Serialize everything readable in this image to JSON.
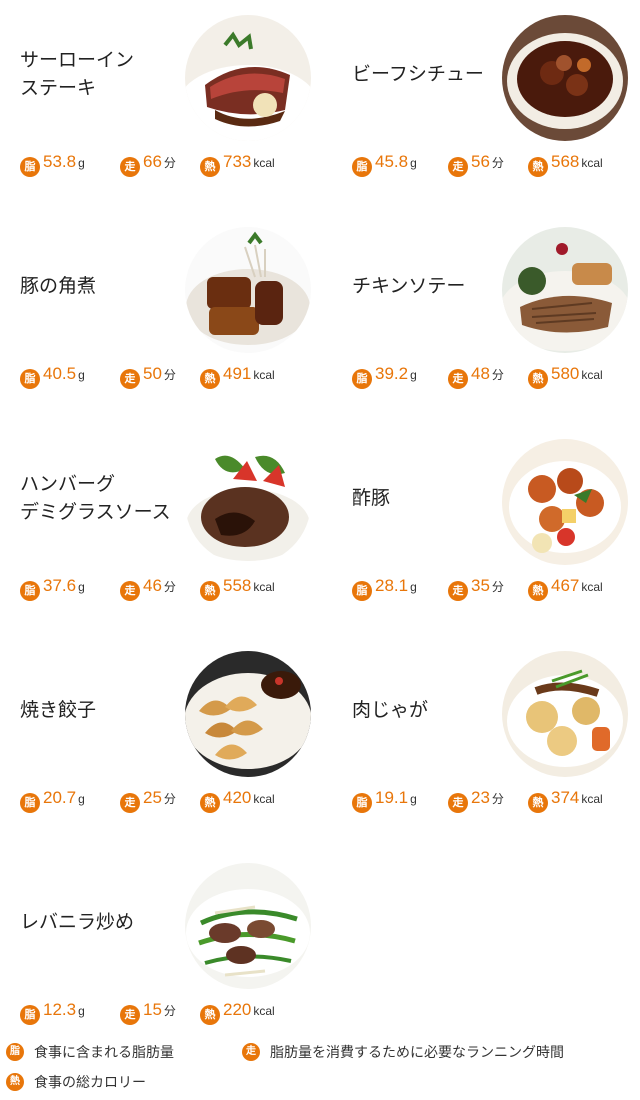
{
  "dishes": [
    {
      "name": "サーローイン\nステーキ",
      "fat": "53.8",
      "fat_unit": "g",
      "run": "66",
      "run_unit": "分",
      "kcal": "733",
      "kcal_unit": "kcal"
    },
    {
      "name": "ビーフシチュー",
      "fat": "45.8",
      "fat_unit": "g",
      "run": "56",
      "run_unit": "分",
      "kcal": "568",
      "kcal_unit": "kcal"
    },
    {
      "name": "豚の角煮",
      "fat": "40.5",
      "fat_unit": "g",
      "run": "50",
      "run_unit": "分",
      "kcal": "491",
      "kcal_unit": "kcal"
    },
    {
      "name": "チキンソテー",
      "fat": "39.2",
      "fat_unit": "g",
      "run": "48",
      "run_unit": "分",
      "kcal": "580",
      "kcal_unit": "kcal"
    },
    {
      "name": "ハンバーグ\nデミグラスソース",
      "fat": "37.6",
      "fat_unit": "g",
      "run": "46",
      "run_unit": "分",
      "kcal": "558",
      "kcal_unit": "kcal"
    },
    {
      "name": "酢豚",
      "fat": "28.1",
      "fat_unit": "g",
      "run": "35",
      "run_unit": "分",
      "kcal": "467",
      "kcal_unit": "kcal"
    },
    {
      "name": "焼き餃子",
      "fat": "20.7",
      "fat_unit": "g",
      "run": "25",
      "run_unit": "分",
      "kcal": "420",
      "kcal_unit": "kcal"
    },
    {
      "name": "肉じゃが",
      "fat": "19.1",
      "fat_unit": "g",
      "run": "23",
      "run_unit": "分",
      "kcal": "374",
      "kcal_unit": "kcal"
    },
    {
      "name": "レバニラ炒め",
      "fat": "12.3",
      "fat_unit": "g",
      "run": "15",
      "run_unit": "分",
      "kcal": "220",
      "kcal_unit": "kcal"
    }
  ],
  "badges": {
    "fat": "脂",
    "run": "走",
    "heat": "熱"
  },
  "legend": {
    "fat": "食事に含まれる脂肪量",
    "run": "脂肪量を消費するために必要なランニング時間",
    "heat": "食事の総カロリー"
  },
  "colors": {
    "accent": "#e8760a"
  }
}
